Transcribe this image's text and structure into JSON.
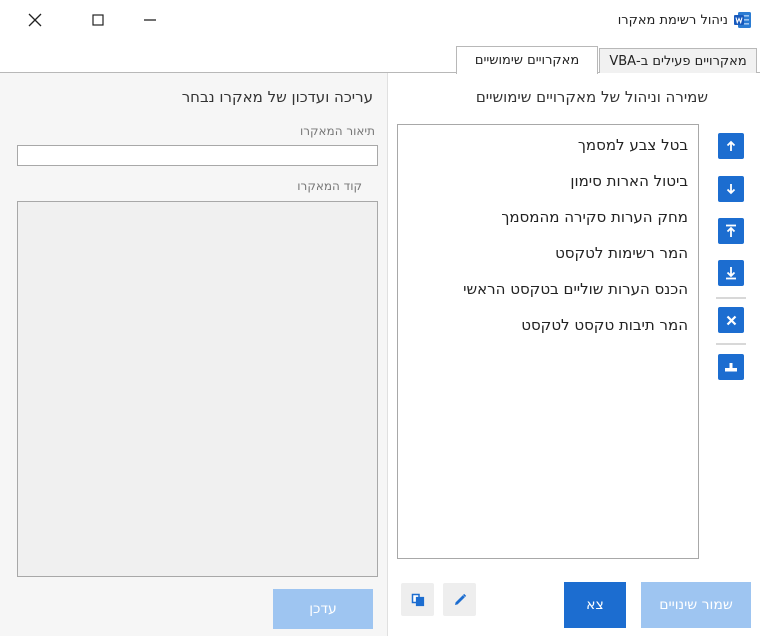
{
  "window": {
    "title": "ניהול רשימת מאקרו",
    "app_icon": "word-icon",
    "controls": [
      "close-icon",
      "maximize-icon",
      "minimize-icon"
    ]
  },
  "tabs": [
    {
      "label": "מאקרויים פעילים ב-VBA",
      "active": false
    },
    {
      "label": "מאקרויים שימושיים",
      "active": true
    }
  ],
  "editor": {
    "heading": "עריכה ועדכון של מאקרו נבחר",
    "description_label": "תיאור המאקרו",
    "description_value": "",
    "code_label": "קוד המאקרו",
    "code_value": "",
    "update_label": "עדכן"
  },
  "manager": {
    "heading": "שמירה וניהול של מאקרויים שימושיים",
    "macros": [
      "בטל צבע למסמך",
      "ביטול הארות סימון",
      "מחק הערות סקירה מהמסמך",
      "המר רשימות לטקסט",
      "הכנס הערות שוליים בטקסט הראשי",
      "המר תיבות טקסט לטקסט"
    ],
    "side_buttons": [
      "arrow-up-icon",
      "arrow-down-icon",
      "move-to-top-icon",
      "move-to-bottom-icon",
      "delete-icon",
      "insert-icon"
    ],
    "exit_label": "צא",
    "save_label": "שמור שינויים"
  },
  "colors": {
    "accent": "#1c6dd0",
    "accent_disabled": "#9ec5f1",
    "panel_bg": "#f6f6f6"
  }
}
